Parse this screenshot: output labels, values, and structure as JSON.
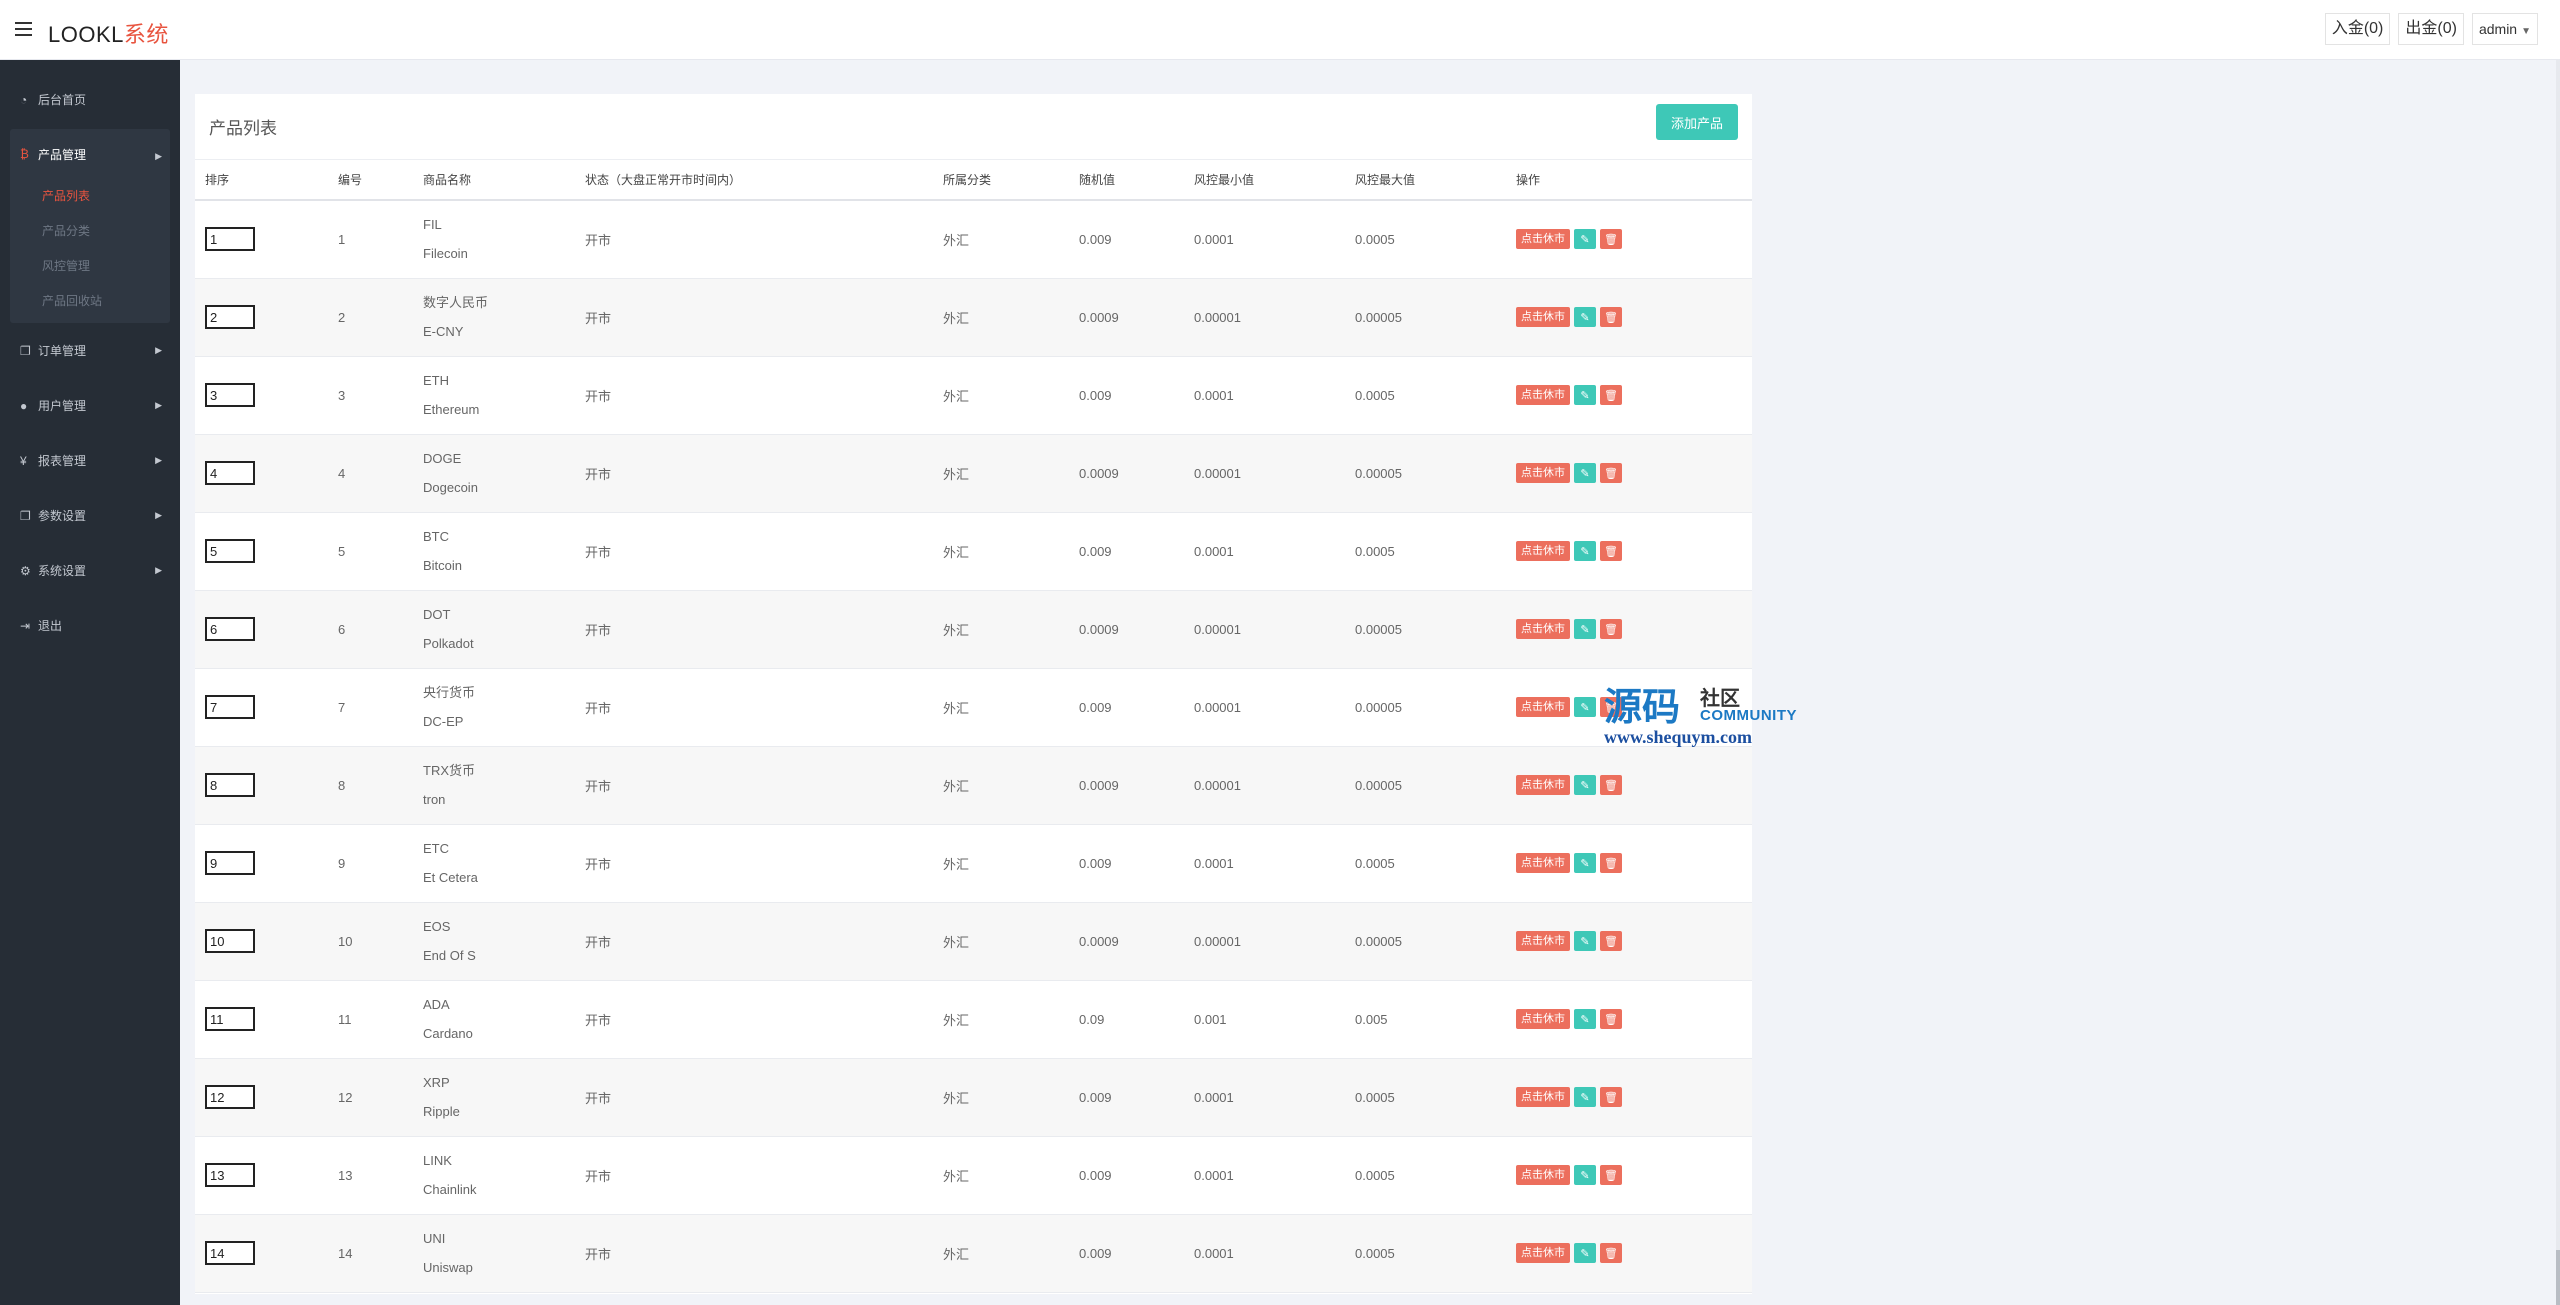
{
  "app": {
    "logo_main": "LOOKL",
    "logo_accent": "系统"
  },
  "header": {
    "deposit_label": "入金(0)",
    "withdraw_label": "出金(0)",
    "user_label": "admin"
  },
  "sidebar": {
    "dashboard": "后台首页",
    "products": "产品管理",
    "product_sub": [
      "产品列表",
      "产品分类",
      "风控管理",
      "产品回收站"
    ],
    "orders": "订单管理",
    "users": "用户管理",
    "reports": "报表管理",
    "params": "参数设置",
    "system": "系统设置",
    "logout": "退出"
  },
  "main": {
    "title": "产品列表",
    "add_button": "添加产品",
    "columns": [
      "排序",
      "编号",
      "商品名称",
      "状态（大盘正常开市时间内）",
      "所属分类",
      "随机值",
      "风控最小值",
      "风控最大值",
      "操作"
    ],
    "stop_label": "点击休市",
    "rows": [
      {
        "sort": "1",
        "id": "1",
        "name1": "FIL",
        "name2": "Filecoin",
        "status": "开市",
        "cat": "外汇",
        "rand": "0.009",
        "min": "0.0001",
        "max": "0.0005"
      },
      {
        "sort": "2",
        "id": "2",
        "name1": "数字人民币",
        "name2": "E-CNY",
        "status": "开市",
        "cat": "外汇",
        "rand": "0.0009",
        "min": "0.00001",
        "max": "0.00005"
      },
      {
        "sort": "3",
        "id": "3",
        "name1": "ETH",
        "name2": "Ethereum",
        "status": "开市",
        "cat": "外汇",
        "rand": "0.009",
        "min": "0.0001",
        "max": "0.0005"
      },
      {
        "sort": "4",
        "id": "4",
        "name1": "DOGE",
        "name2": "Dogecoin",
        "status": "开市",
        "cat": "外汇",
        "rand": "0.0009",
        "min": "0.00001",
        "max": "0.00005"
      },
      {
        "sort": "5",
        "id": "5",
        "name1": "BTC",
        "name2": "Bitcoin",
        "status": "开市",
        "cat": "外汇",
        "rand": "0.009",
        "min": "0.0001",
        "max": "0.0005"
      },
      {
        "sort": "6",
        "id": "6",
        "name1": "DOT",
        "name2": "Polkadot",
        "status": "开市",
        "cat": "外汇",
        "rand": "0.0009",
        "min": "0.00001",
        "max": "0.00005"
      },
      {
        "sort": "7",
        "id": "7",
        "name1": "央行货币",
        "name2": "DC-EP",
        "status": "开市",
        "cat": "外汇",
        "rand": "0.009",
        "min": "0.00001",
        "max": "0.00005"
      },
      {
        "sort": "8",
        "id": "8",
        "name1": "TRX货币",
        "name2": "tron",
        "status": "开市",
        "cat": "外汇",
        "rand": "0.0009",
        "min": "0.00001",
        "max": "0.00005"
      },
      {
        "sort": "9",
        "id": "9",
        "name1": "ETC",
        "name2": "Et Cetera",
        "status": "开市",
        "cat": "外汇",
        "rand": "0.009",
        "min": "0.0001",
        "max": "0.0005"
      },
      {
        "sort": "10",
        "id": "10",
        "name1": "EOS",
        "name2": "End Of S",
        "status": "开市",
        "cat": "外汇",
        "rand": "0.0009",
        "min": "0.00001",
        "max": "0.00005"
      },
      {
        "sort": "11",
        "id": "11",
        "name1": "ADA",
        "name2": "Cardano",
        "status": "开市",
        "cat": "外汇",
        "rand": "0.09",
        "min": "0.001",
        "max": "0.005"
      },
      {
        "sort": "12",
        "id": "12",
        "name1": "XRP",
        "name2": "Ripple",
        "status": "开市",
        "cat": "外汇",
        "rand": "0.009",
        "min": "0.0001",
        "max": "0.0005"
      },
      {
        "sort": "13",
        "id": "13",
        "name1": "LINK",
        "name2": "Chainlink",
        "status": "开市",
        "cat": "外汇",
        "rand": "0.009",
        "min": "0.0001",
        "max": "0.0005"
      },
      {
        "sort": "14",
        "id": "14",
        "name1": "UNI",
        "name2": "Uniswap",
        "status": "开市",
        "cat": "外汇",
        "rand": "0.009",
        "min": "0.0001",
        "max": "0.0005"
      }
    ]
  },
  "watermark": {
    "big": "源码",
    "small1": "社区",
    "small2": "COMMUNITY",
    "url": "www.shequym.com"
  },
  "colors": {
    "accent_red": "#e8543f",
    "teal": "#3ec8b7",
    "sidebar_bg": "#262d36"
  }
}
